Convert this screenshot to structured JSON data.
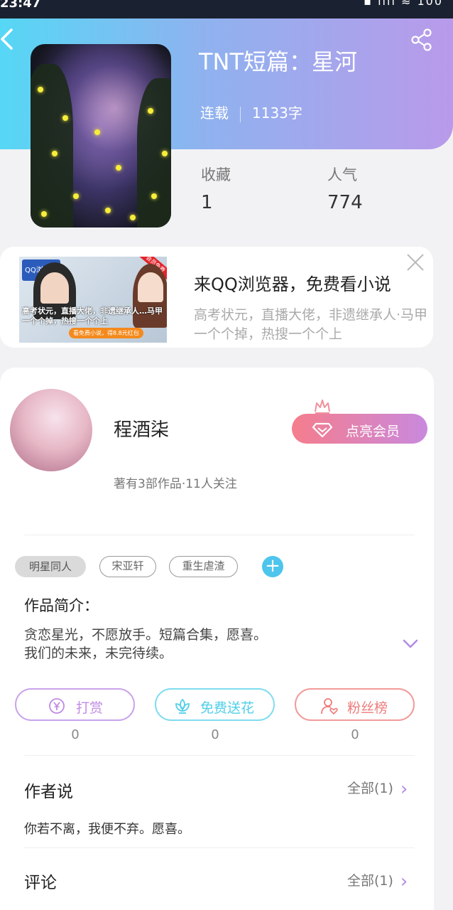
{
  "status_bar": {
    "time": "23:47",
    "system_icons": "▪ ıııl ≋ 100"
  },
  "book": {
    "title": "TNT短篇：星河",
    "status": "连载",
    "word_count": "1133字",
    "stats": [
      {
        "label": "收藏",
        "value": "1"
      },
      {
        "label": "人气",
        "value": "774"
      }
    ]
  },
  "ad": {
    "title": "来QQ浏览器，免费看小说",
    "description": "高考状元，直播大佬，非遗继承人·马甲一个个掉，热搜一个个上",
    "image_tag": "QQ浏览器",
    "image_corner": "会员免费",
    "image_text": "高考状元，直播大佬，非遗继承人…马甲一个个掉，热搜一个个上",
    "image_cta": "看免费小说，得8.8元红包"
  },
  "author": {
    "name": "程酒柒",
    "meta": "著有3部作品·11人关注",
    "vip_button": "点亮会员"
  },
  "tags": [
    "明星同人",
    "宋亚轩",
    "重生虐渣"
  ],
  "intro": {
    "heading": "作品简介：",
    "lines": [
      "贪恋星光，不愿放手。短篇合集，愿喜。",
      "我们的未来，未完待续。"
    ]
  },
  "actions": [
    {
      "label": "打赏",
      "count": "0",
      "color": "#c08be5"
    },
    {
      "label": "免费送花",
      "count": "0",
      "color": "#4fcfe8"
    },
    {
      "label": "粉丝榜",
      "count": "0",
      "color": "#ef7b7b"
    }
  ],
  "author_says": {
    "heading": "作者说",
    "more": "全部(1)",
    "text": "你若不离，我便不弃。愿喜。"
  },
  "comments": {
    "heading": "评论",
    "more": "全部(1)"
  },
  "accent_color": "#b28be6"
}
